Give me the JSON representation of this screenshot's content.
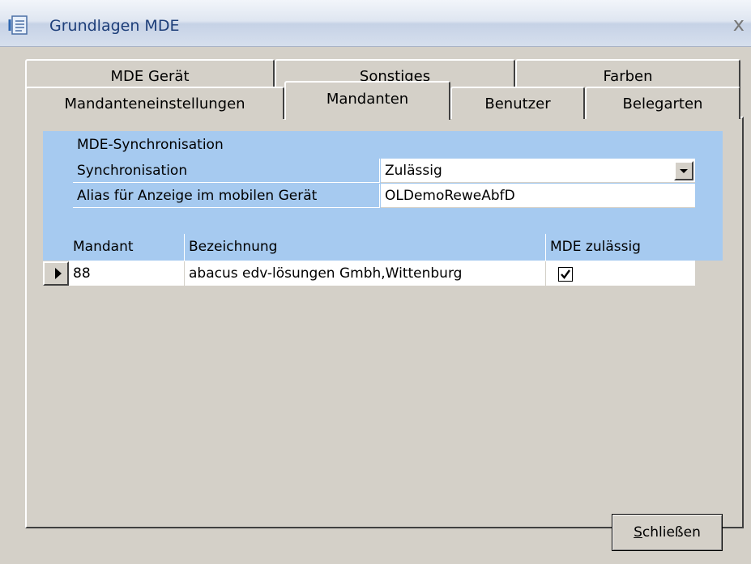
{
  "window": {
    "title": "Grundlagen MDE",
    "close_glyph": "x"
  },
  "tabs": {
    "row_back": [
      "MDE Gerät",
      "Sonstiges",
      "Farben"
    ],
    "row_front": [
      "Mandanteneinstellungen",
      "Mandanten",
      "Benutzer",
      "Belegarten"
    ],
    "active": "Mandanten"
  },
  "sync": {
    "section_title": "MDE-Synchronisation",
    "rows": [
      {
        "label": "Synchronisation",
        "value": "Zulässig"
      },
      {
        "label": "Alias für Anzeige im mobilen Gerät",
        "value": "OLDemoReweAbfD"
      }
    ]
  },
  "grid": {
    "columns": [
      "Mandant",
      "Bezeichnung",
      "MDE zulässig"
    ],
    "rows": [
      {
        "mandant": "88",
        "bezeichnung": "abacus edv-lösungen Gmbh,Wittenburg",
        "mde_zulaessig": true
      }
    ]
  },
  "footer": {
    "close_mnemonic": "S",
    "close_rest": "chließen"
  },
  "colors": {
    "grid_blue": "#a6caf0",
    "dialog_gray": "#d4d0c8",
    "title_text": "#1e3f7a"
  }
}
